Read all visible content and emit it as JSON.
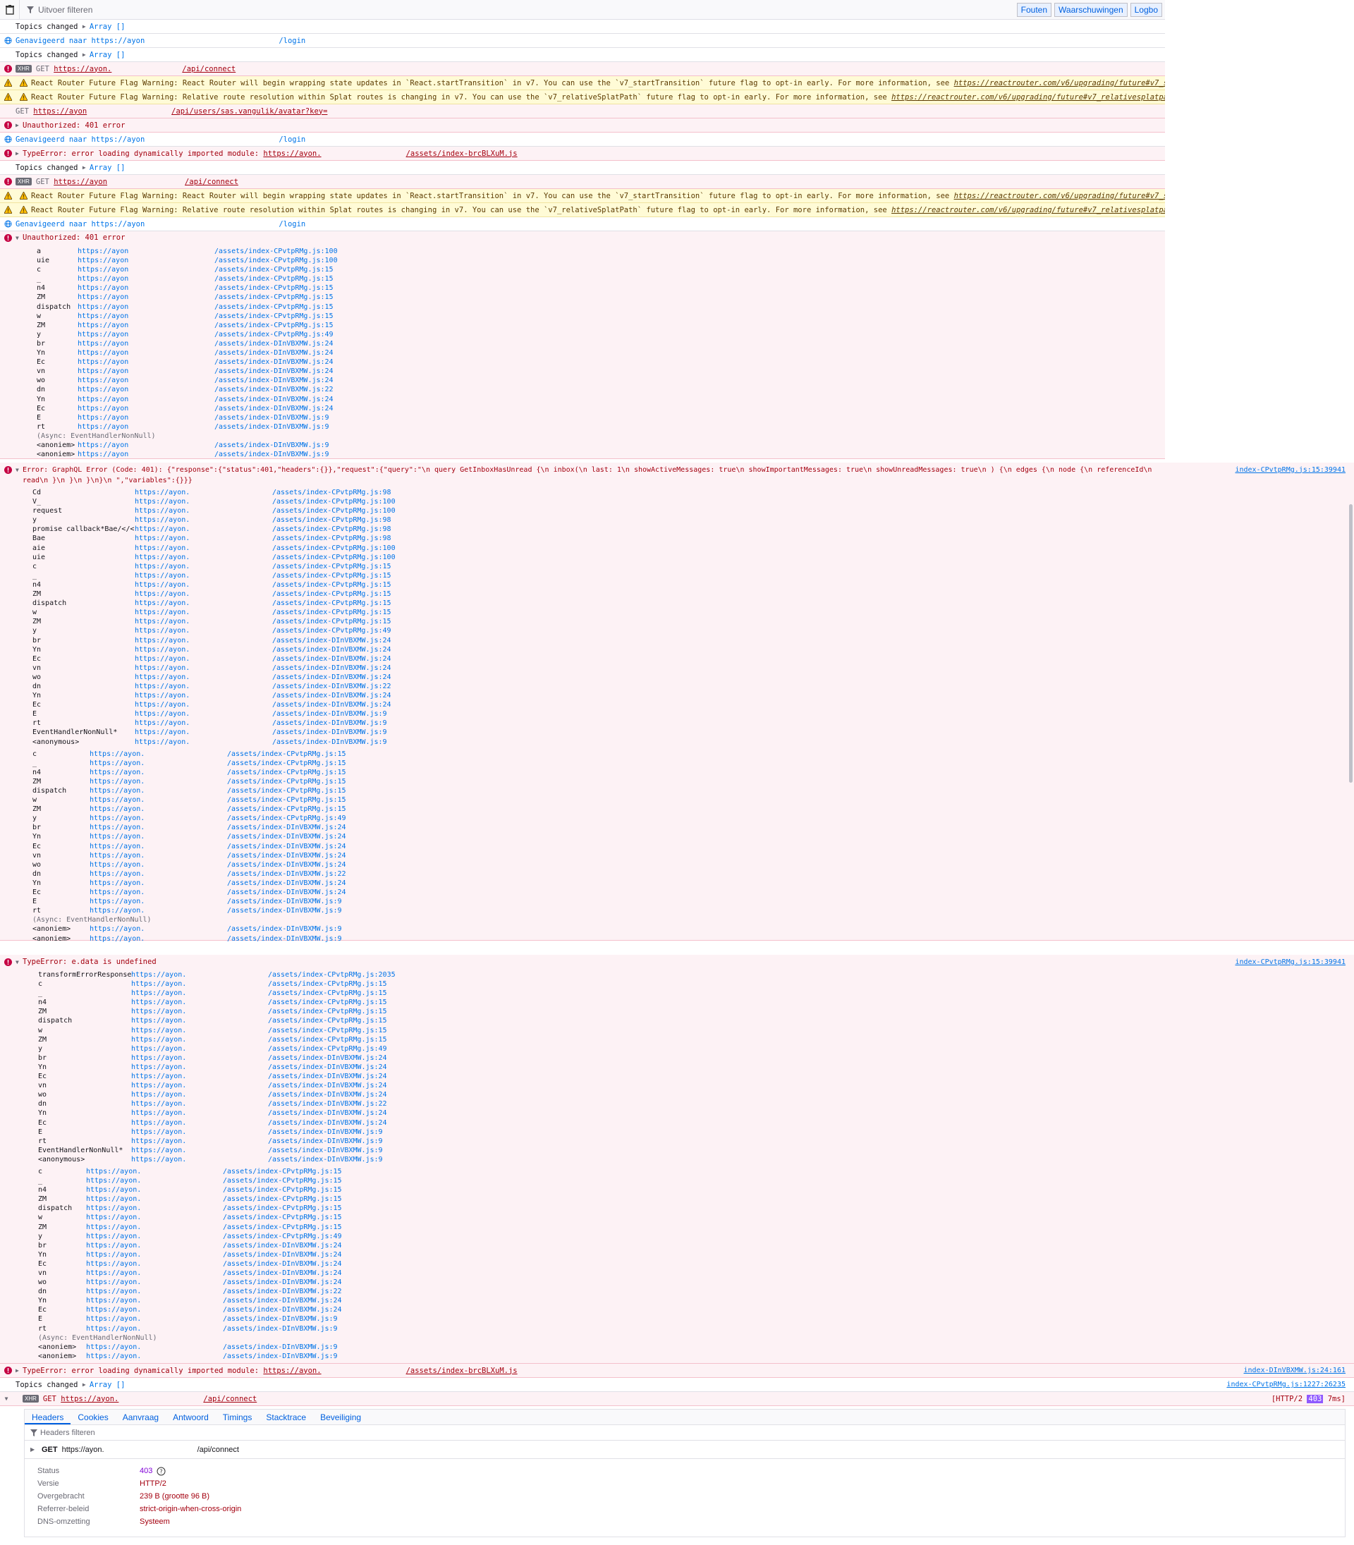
{
  "toolbar": {
    "filter_placeholder": "Uitvoer filteren",
    "buttons": [
      "Fouten",
      "Waarschuwingen",
      "Logbo"
    ]
  },
  "messages": [
    {
      "kind": "log",
      "text": "Topics changed",
      "obj": "Array []"
    },
    {
      "kind": "nav",
      "text": "Genavigeerd naar https://ayon",
      "path": "/login"
    },
    {
      "kind": "log",
      "text": "Topics changed",
      "obj": "Array []"
    },
    {
      "kind": "xhr-err",
      "method": "GET",
      "url": "https://ayon.",
      "path": "/api/connect"
    },
    {
      "kind": "warn",
      "text": "React Router Future Flag Warning: React Router will begin wrapping state updates in `React.startTransition` in v7. You can use the `v7_startTransition` future flag to opt-in early. For more information, see",
      "link": "https://reactrouter.com/v6/upgrading/future#v7_starttransition"
    },
    {
      "kind": "warn",
      "text": "React Router Future Flag Warning: Relative route resolution within Splat routes is changing in v7. You can use the `v7_relativeSplatPath` future flag to opt-in early. For more information, see",
      "link": "https://reactrouter.com/v6/upgrading/future#v7_relativesplatpath"
    },
    {
      "kind": "get-err",
      "method": "GET",
      "url": "https://ayon",
      "path": "/api/users/sas.vangulik/avatar?key="
    },
    {
      "kind": "err",
      "text": "Unauthorized: 401 error"
    },
    {
      "kind": "nav",
      "text": "Genavigeerd naar https://ayon",
      "path": "/login"
    },
    {
      "kind": "err",
      "text": "TypeError: error loading dynamically imported module:",
      "url": "https://ayon.",
      "path": "/assets/index-brcBLXuM.js"
    },
    {
      "kind": "log",
      "text": "Topics changed",
      "obj": "Array []"
    },
    {
      "kind": "xhr-err",
      "method": "GET",
      "url": "https://ayon",
      "path": "/api/connect"
    },
    {
      "kind": "warn",
      "text": "React Router Future Flag Warning: React Router will begin wrapping state updates in `React.startTransition` in v7. You can use the `v7_startTransition` future flag to opt-in early. For more information, see",
      "link": "https://reactrouter.com/v6/upgrading/future#v7_starttransition"
    },
    {
      "kind": "warn",
      "text": "React Router Future Flag Warning: Relative route resolution within Splat routes is changing in v7. You can use the `v7_relativeSplatPath` future flag to opt-in early. For more information, see",
      "link": "https://reactrouter.com/v6/upgrading/future#v7_relativesplatpath"
    },
    {
      "kind": "nav",
      "text": "Genavigeerd naar https://ayon",
      "path": "/login"
    }
  ],
  "stack1": {
    "title": "Unauthorized: 401 error",
    "host": "https://ayon",
    "frames": [
      [
        "a",
        "/assets/index-CPvtpRMg.js:100"
      ],
      [
        "uie",
        "/assets/index-CPvtpRMg.js:100"
      ],
      [
        "c",
        "/assets/index-CPvtpRMg.js:15"
      ],
      [
        "_",
        "/assets/index-CPvtpRMg.js:15"
      ],
      [
        "n4",
        "/assets/index-CPvtpRMg.js:15"
      ],
      [
        "ZM",
        "/assets/index-CPvtpRMg.js:15"
      ],
      [
        "dispatch",
        "/assets/index-CPvtpRMg.js:15"
      ],
      [
        "w",
        "/assets/index-CPvtpRMg.js:15"
      ],
      [
        "ZM",
        "/assets/index-CPvtpRMg.js:15"
      ],
      [
        "y",
        "/assets/index-CPvtpRMg.js:49"
      ],
      [
        "br",
        "/assets/index-DInVBXMW.js:24"
      ],
      [
        "Yn",
        "/assets/index-DInVBXMW.js:24"
      ],
      [
        "Ec",
        "/assets/index-DInVBXMW.js:24"
      ],
      [
        "vn",
        "/assets/index-DInVBXMW.js:24"
      ],
      [
        "wo",
        "/assets/index-DInVBXMW.js:24"
      ],
      [
        "dn",
        "/assets/index-DInVBXMW.js:22"
      ],
      [
        "Yn",
        "/assets/index-DInVBXMW.js:24"
      ],
      [
        "Ec",
        "/assets/index-DInVBXMW.js:24"
      ],
      [
        "E",
        "/assets/index-DInVBXMW.js:9"
      ],
      [
        "rt",
        "/assets/index-DInVBXMW.js:9"
      ]
    ],
    "async": "(Async: EventHandlerNonNull)",
    "tail": [
      [
        "<anoniem>",
        "/assets/index-DInVBXMW.js:9"
      ],
      [
        "<anoniem>",
        "/assets/index-DInVBXMW.js:9"
      ]
    ]
  },
  "stack2": {
    "title": "Error: GraphQL Error (Code: 401): {\"response\":{\"status\":401,\"headers\":{}},\"request\":{\"query\":\"\\n    query GetInboxHasUnread {\\n  inbox(\\n    last: 1\\n    showActiveMessages: true\\n    showImportantMessages: true\\n    showUnreadMessages: true\\n  ) {\\n    edges {\\n      node {\\n        referenceId\\n",
    "title2": "read\\n      }\\n    }\\n  }\\n}\\n    \",\"variables\":{}}}",
    "src": "index-CPvtpRMg.js:15:39941",
    "host": "https://ayon.",
    "frames": [
      [
        "Cd",
        "/assets/index-CPvtpRMg.js:98"
      ],
      [
        "V_",
        "/assets/index-CPvtpRMg.js:100"
      ],
      [
        "request",
        "/assets/index-CPvtpRMg.js:100"
      ],
      [
        "y",
        "/assets/index-CPvtpRMg.js:98"
      ],
      [
        "promise callback*Bae/</<",
        "/assets/index-CPvtpRMg.js:98"
      ],
      [
        "Bae",
        "/assets/index-CPvtpRMg.js:98"
      ],
      [
        "aie",
        "/assets/index-CPvtpRMg.js:100"
      ],
      [
        "uie",
        "/assets/index-CPvtpRMg.js:100"
      ],
      [
        "c",
        "/assets/index-CPvtpRMg.js:15"
      ],
      [
        "_",
        "/assets/index-CPvtpRMg.js:15"
      ],
      [
        "n4",
        "/assets/index-CPvtpRMg.js:15"
      ],
      [
        "ZM",
        "/assets/index-CPvtpRMg.js:15"
      ],
      [
        "dispatch",
        "/assets/index-CPvtpRMg.js:15"
      ],
      [
        "w",
        "/assets/index-CPvtpRMg.js:15"
      ],
      [
        "ZM",
        "/assets/index-CPvtpRMg.js:15"
      ],
      [
        "y",
        "/assets/index-CPvtpRMg.js:49"
      ],
      [
        "br",
        "/assets/index-DInVBXMW.js:24"
      ],
      [
        "Yn",
        "/assets/index-DInVBXMW.js:24"
      ],
      [
        "Ec",
        "/assets/index-DInVBXMW.js:24"
      ],
      [
        "vn",
        "/assets/index-DInVBXMW.js:24"
      ],
      [
        "wo",
        "/assets/index-DInVBXMW.js:24"
      ],
      [
        "dn",
        "/assets/index-DInVBXMW.js:22"
      ],
      [
        "Yn",
        "/assets/index-DInVBXMW.js:24"
      ],
      [
        "Ec",
        "/assets/index-DInVBXMW.js:24"
      ],
      [
        "E",
        "/assets/index-DInVBXMW.js:9"
      ],
      [
        "rt",
        "/assets/index-DInVBXMW.js:9"
      ],
      [
        "EventHandlerNonNull*",
        "/assets/index-DInVBXMW.js:9"
      ],
      [
        "<anonymous>",
        "/assets/index-DInVBXMW.js:9"
      ]
    ],
    "frames2": [
      [
        "c",
        "/assets/index-CPvtpRMg.js:15"
      ],
      [
        "_",
        "/assets/index-CPvtpRMg.js:15"
      ],
      [
        "n4",
        "/assets/index-CPvtpRMg.js:15"
      ],
      [
        "ZM",
        "/assets/index-CPvtpRMg.js:15"
      ],
      [
        "dispatch",
        "/assets/index-CPvtpRMg.js:15"
      ],
      [
        "w",
        "/assets/index-CPvtpRMg.js:15"
      ],
      [
        "ZM",
        "/assets/index-CPvtpRMg.js:15"
      ],
      [
        "y",
        "/assets/index-CPvtpRMg.js:49"
      ],
      [
        "br",
        "/assets/index-DInVBXMW.js:24"
      ],
      [
        "Yn",
        "/assets/index-DInVBXMW.js:24"
      ],
      [
        "Ec",
        "/assets/index-DInVBXMW.js:24"
      ],
      [
        "vn",
        "/assets/index-DInVBXMW.js:24"
      ],
      [
        "wo",
        "/assets/index-DInVBXMW.js:24"
      ],
      [
        "dn",
        "/assets/index-DInVBXMW.js:22"
      ],
      [
        "Yn",
        "/assets/index-DInVBXMW.js:24"
      ],
      [
        "Ec",
        "/assets/index-DInVBXMW.js:24"
      ],
      [
        "E",
        "/assets/index-DInVBXMW.js:9"
      ],
      [
        "rt",
        "/assets/index-DInVBXMW.js:9"
      ]
    ],
    "async": "(Async: EventHandlerNonNull)",
    "tail": [
      [
        "<anoniem>",
        "/assets/index-DInVBXMW.js:9"
      ],
      [
        "<anoniem>",
        "/assets/index-DInVBXMW.js:9"
      ]
    ]
  },
  "stack3": {
    "title": "TypeError: e.data is undefined",
    "src": "index-CPvtpRMg.js:15:39941",
    "host": "https://ayon.",
    "frames": [
      [
        "transformErrorResponse",
        "/assets/index-CPvtpRMg.js:2035"
      ],
      [
        "c",
        "/assets/index-CPvtpRMg.js:15"
      ],
      [
        "_",
        "/assets/index-CPvtpRMg.js:15"
      ],
      [
        "n4",
        "/assets/index-CPvtpRMg.js:15"
      ],
      [
        "ZM",
        "/assets/index-CPvtpRMg.js:15"
      ],
      [
        "dispatch",
        "/assets/index-CPvtpRMg.js:15"
      ],
      [
        "w",
        "/assets/index-CPvtpRMg.js:15"
      ],
      [
        "ZM",
        "/assets/index-CPvtpRMg.js:15"
      ],
      [
        "y",
        "/assets/index-CPvtpRMg.js:49"
      ],
      [
        "br",
        "/assets/index-DInVBXMW.js:24"
      ],
      [
        "Yn",
        "/assets/index-DInVBXMW.js:24"
      ],
      [
        "Ec",
        "/assets/index-DInVBXMW.js:24"
      ],
      [
        "vn",
        "/assets/index-DInVBXMW.js:24"
      ],
      [
        "wo",
        "/assets/index-DInVBXMW.js:24"
      ],
      [
        "dn",
        "/assets/index-DInVBXMW.js:22"
      ],
      [
        "Yn",
        "/assets/index-DInVBXMW.js:24"
      ],
      [
        "Ec",
        "/assets/index-DInVBXMW.js:24"
      ],
      [
        "E",
        "/assets/index-DInVBXMW.js:9"
      ],
      [
        "rt",
        "/assets/index-DInVBXMW.js:9"
      ],
      [
        "EventHandlerNonNull*",
        "/assets/index-DInVBXMW.js:9"
      ],
      [
        "<anonymous>",
        "/assets/index-DInVBXMW.js:9"
      ]
    ],
    "frames2": [
      [
        "c",
        "/assets/index-CPvtpRMg.js:15"
      ],
      [
        "_",
        "/assets/index-CPvtpRMg.js:15"
      ],
      [
        "n4",
        "/assets/index-CPvtpRMg.js:15"
      ],
      [
        "ZM",
        "/assets/index-CPvtpRMg.js:15"
      ],
      [
        "dispatch",
        "/assets/index-CPvtpRMg.js:15"
      ],
      [
        "w",
        "/assets/index-CPvtpRMg.js:15"
      ],
      [
        "ZM",
        "/assets/index-CPvtpRMg.js:15"
      ],
      [
        "y",
        "/assets/index-CPvtpRMg.js:49"
      ],
      [
        "br",
        "/assets/index-DInVBXMW.js:24"
      ],
      [
        "Yn",
        "/assets/index-DInVBXMW.js:24"
      ],
      [
        "Ec",
        "/assets/index-DInVBXMW.js:24"
      ],
      [
        "vn",
        "/assets/index-DInVBXMW.js:24"
      ],
      [
        "wo",
        "/assets/index-DInVBXMW.js:24"
      ],
      [
        "dn",
        "/assets/index-DInVBXMW.js:22"
      ],
      [
        "Yn",
        "/assets/index-DInVBXMW.js:24"
      ],
      [
        "Ec",
        "/assets/index-DInVBXMW.js:24"
      ],
      [
        "E",
        "/assets/index-DInVBXMW.js:9"
      ],
      [
        "rt",
        "/assets/index-DInVBXMW.js:9"
      ]
    ],
    "async": "(Async: EventHandlerNonNull)",
    "tail": [
      [
        "<anoniem>",
        "/assets/index-DInVBXMW.js:9"
      ],
      [
        "<anoniem>",
        "/assets/index-DInVBXMW.js:9"
      ]
    ]
  },
  "bottom": {
    "err_text": "TypeError: error loading dynamically imported module:",
    "err_url": "https://ayon.",
    "err_path": "/assets/index-brcBLXuM.js",
    "err_src": "index-DInVBXMW.js:24:161",
    "topics_text": "Topics changed",
    "topics_obj": "Array []",
    "topics_src": "index-CPvtpRMg.js:1227:26235",
    "xhr_method": "GET",
    "xhr_url": "https://ayon.",
    "xhr_path": "/api/connect",
    "xhr_proto": "HTTP/2",
    "xhr_status": "403",
    "xhr_time": "7ms"
  },
  "detail": {
    "tabs": [
      "Headers",
      "Cookies",
      "Aanvraag",
      "Antwoord",
      "Timings",
      "Stacktrace",
      "Beveiliging"
    ],
    "filter_placeholder": "Headers filteren",
    "req_method": "GET",
    "req_url": "https://ayon.",
    "req_path": "/api/connect",
    "rows": [
      {
        "k": "Status",
        "v": "403"
      },
      {
        "k": "Versie",
        "v": "HTTP/2"
      },
      {
        "k": "Overgebracht",
        "v": "239 B (grootte 96 B)"
      },
      {
        "k": "Referrer-beleid",
        "v": "strict-origin-when-cross-origin"
      },
      {
        "k": "DNS-omzetting",
        "v": "Systeem"
      }
    ]
  },
  "colors": {
    "error": "#a4000f",
    "warning": "#5c3b00",
    "link": "#0074e8",
    "accent": "#0060df"
  }
}
